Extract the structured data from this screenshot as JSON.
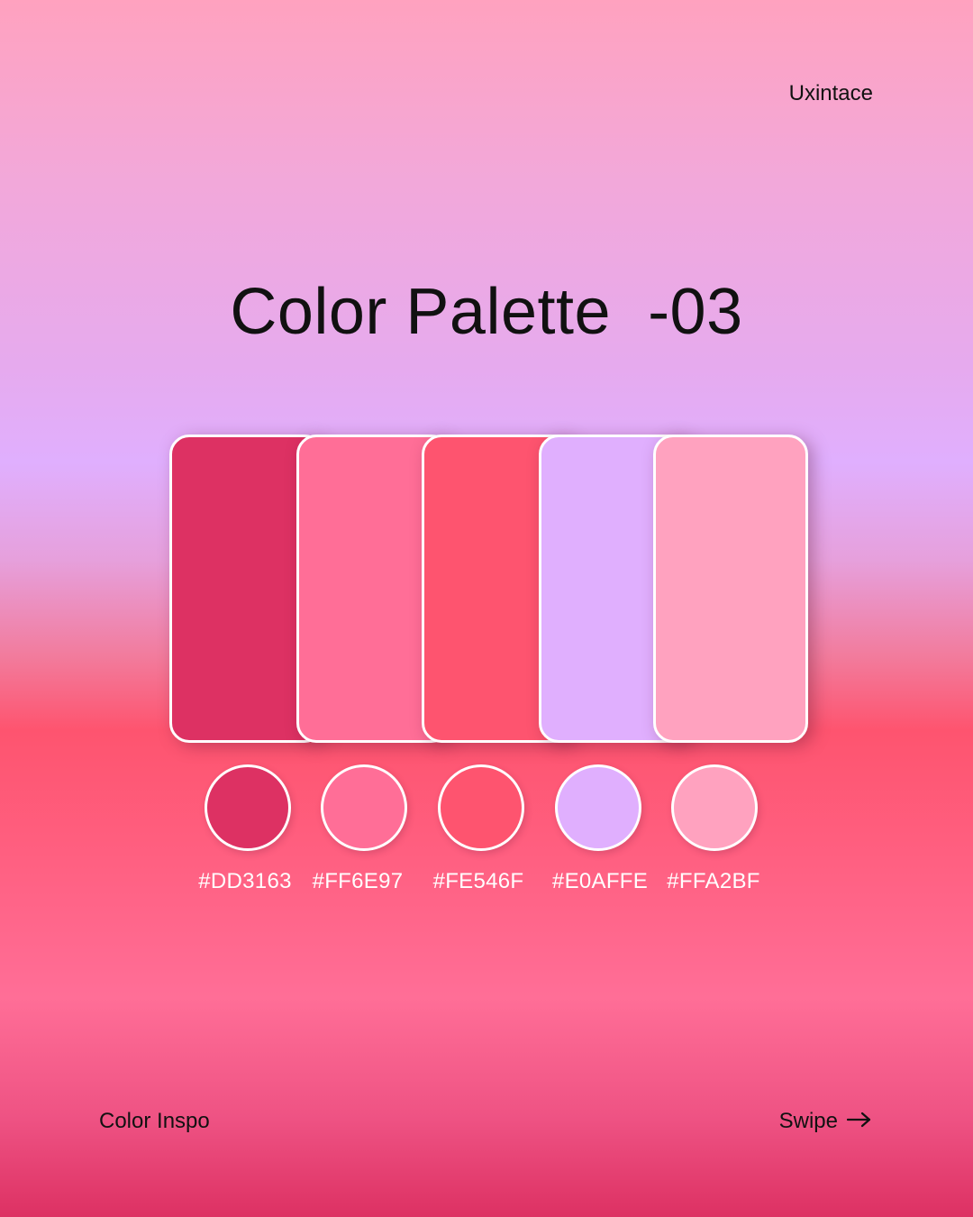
{
  "brand": "Uxintace",
  "title": "Color Palette  -03",
  "palette": [
    {
      "hex": "#DD3163",
      "color": "#DD3163"
    },
    {
      "hex": "#FF6E97",
      "color": "#FF6E97"
    },
    {
      "hex": "#FE546F",
      "color": "#FE546F"
    },
    {
      "hex": "#E0AFFE",
      "color": "#E0AFFE"
    },
    {
      "hex": "#FFA2BF",
      "color": "#FFA2BF"
    }
  ],
  "footer": {
    "left": "Color Inspo",
    "right": "Swipe",
    "right_icon": "arrow-right-icon"
  }
}
